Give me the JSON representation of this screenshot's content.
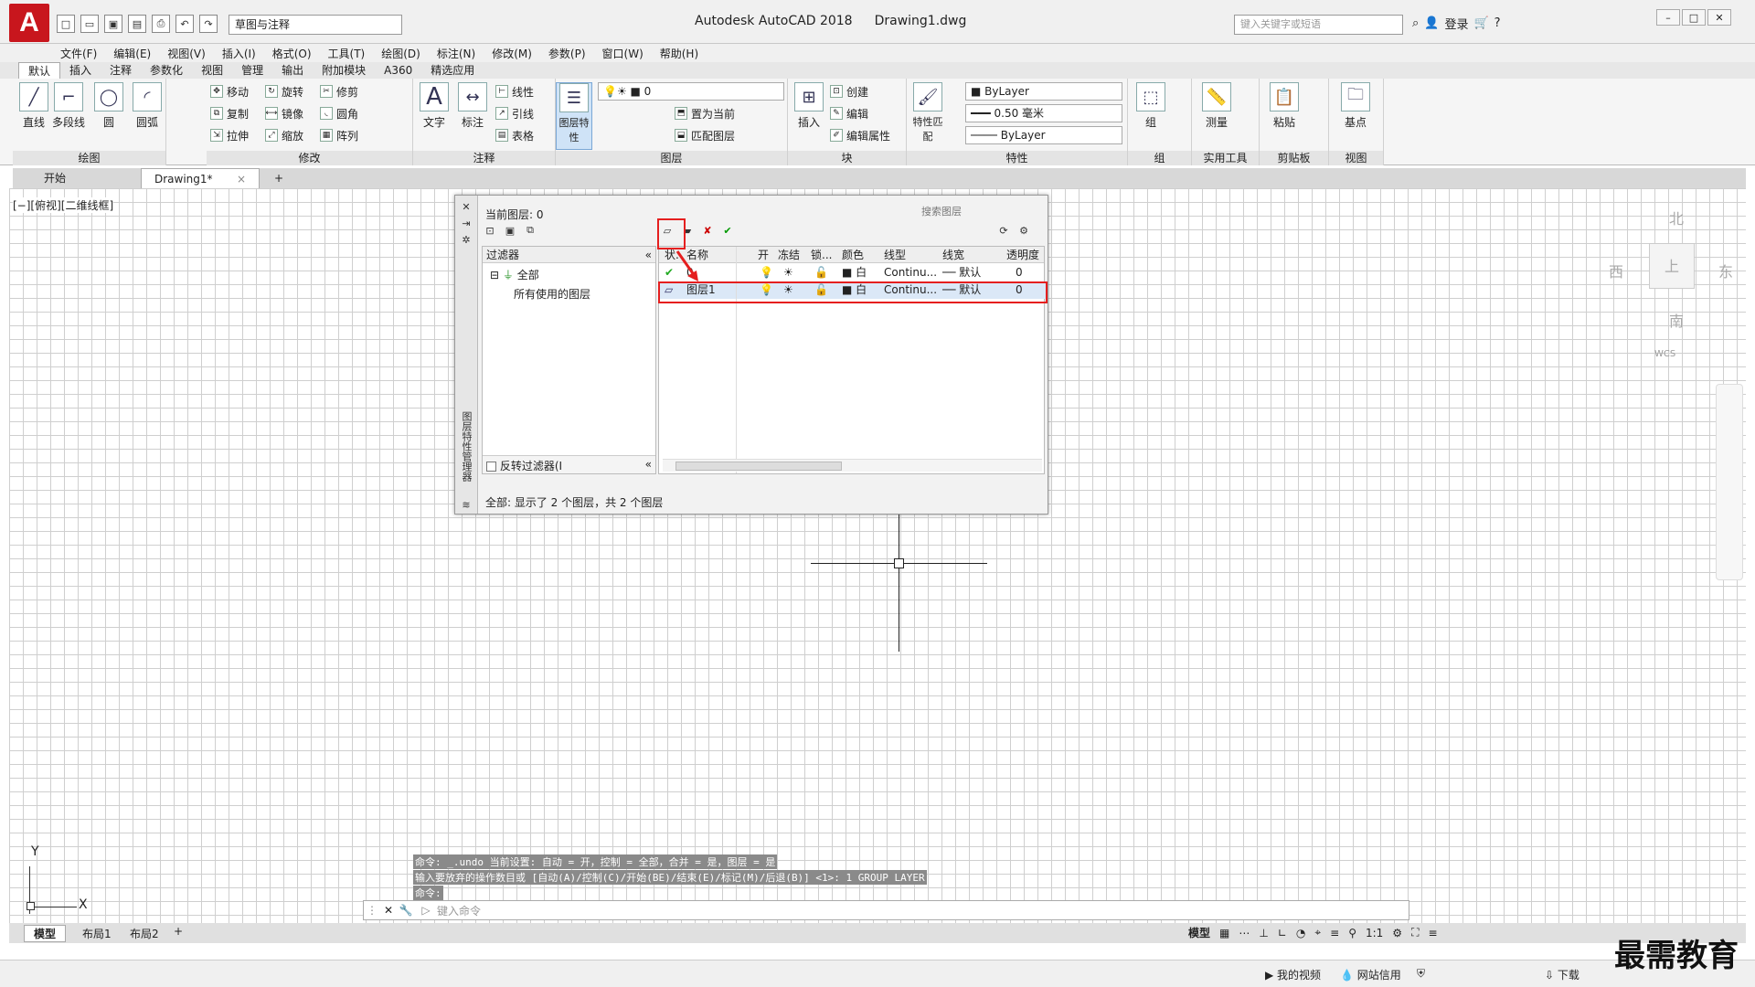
{
  "app": {
    "logo": "A",
    "title": "Autodesk AutoCAD 2018",
    "document": "Drawing1.dwg",
    "workspace": "草图与注释",
    "search_placeholder": "键入关键字或短语",
    "login": "登录"
  },
  "menu": [
    "文件(F)",
    "编辑(E)",
    "视图(V)",
    "插入(I)",
    "格式(O)",
    "工具(T)",
    "绘图(D)",
    "标注(N)",
    "修改(M)",
    "参数(P)",
    "窗口(W)",
    "帮助(H)"
  ],
  "ribbon_tabs": [
    "默认",
    "插入",
    "注释",
    "参数化",
    "视图",
    "管理",
    "输出",
    "附加模块",
    "A360",
    "精选应用"
  ],
  "ribbon": {
    "draw": {
      "title": "绘图",
      "line": "直线",
      "polyline": "多段线",
      "circle": "圆",
      "arc": "圆弧"
    },
    "modify": {
      "title": "修改",
      "move": "移动",
      "rotate": "旋转",
      "trim": "修剪",
      "copy": "复制",
      "mirror": "镜像",
      "fillet": "圆角",
      "stretch": "拉伸",
      "scale": "缩放",
      "array": "阵列"
    },
    "annotation": {
      "title": "注释",
      "text": "文字",
      "dimension": "标注",
      "linear": "线性",
      "leader": "引线",
      "table": "表格"
    },
    "layers": {
      "title": "图层",
      "props": "图层特性",
      "current_layer": "0",
      "set_current": "置为当前",
      "match": "匹配图层"
    },
    "block": {
      "title": "块",
      "insert": "插入",
      "create": "创建",
      "edit": "编辑",
      "edit_attr": "编辑属性"
    },
    "properties": {
      "title": "特性",
      "match": "特性匹配",
      "color": "ByLayer",
      "lineweight": "0.50 毫米",
      "linetype": "ByLayer"
    },
    "groups": {
      "title": "组",
      "group": "组"
    },
    "utilities": {
      "title": "实用工具",
      "measure": "测量"
    },
    "clipboard": {
      "title": "剪贴板",
      "paste": "粘贴"
    },
    "view": {
      "title": "视图",
      "base": "基点"
    }
  },
  "doc_tabs": {
    "start": "开始",
    "drawing": "Drawing1*"
  },
  "viewport_label": "[−][俯视][二维线框]",
  "layer_manager": {
    "side_title": "图层特性管理器",
    "current": "当前图层: 0",
    "search_placeholder": "搜索图层",
    "filters_header": "过滤器",
    "filter_all": "全部",
    "filter_used": "所有使用的图层",
    "invert_filter": "反转过滤器(I",
    "columns": [
      "状.",
      "名称",
      "开",
      "冻结",
      "锁...",
      "颜色",
      "线型",
      "线宽",
      "透明度"
    ],
    "rows": [
      {
        "status": "✔",
        "name": "0",
        "color": "白",
        "linetype": "Continu...",
        "lineweight": "默认",
        "transparency": "0"
      },
      {
        "status": "▱",
        "name": "图层1",
        "color": "白",
        "linetype": "Continu...",
        "lineweight": "默认",
        "transparency": "0"
      }
    ],
    "status_text": "全部: 显示了 2 个图层，共 2 个图层"
  },
  "viewcube": {
    "north": "北",
    "south": "南",
    "east": "东",
    "west": "西",
    "top": "上",
    "wcs": "WCS"
  },
  "ucs": {
    "x": "X",
    "y": "Y"
  },
  "command": {
    "history": [
      "命令: _.undo 当前设置: 自动 = 开，控制 = 全部，合并 = 是，图层 = 是",
      "输入要放弃的操作数目或 [自动(A)/控制(C)/开始(BE)/结束(E)/标记(M)/后退(B)] <1>: 1 GROUP LAYER",
      "命令:"
    ],
    "placeholder": "键入命令"
  },
  "layout_tabs": [
    "模型",
    "布局1",
    "布局2"
  ],
  "status": {
    "model": "模型",
    "scale": "1:1"
  },
  "taskbar": {
    "video": "我的视频",
    "network": "网站信用",
    "download": "下载"
  },
  "watermark": "最需教育"
}
